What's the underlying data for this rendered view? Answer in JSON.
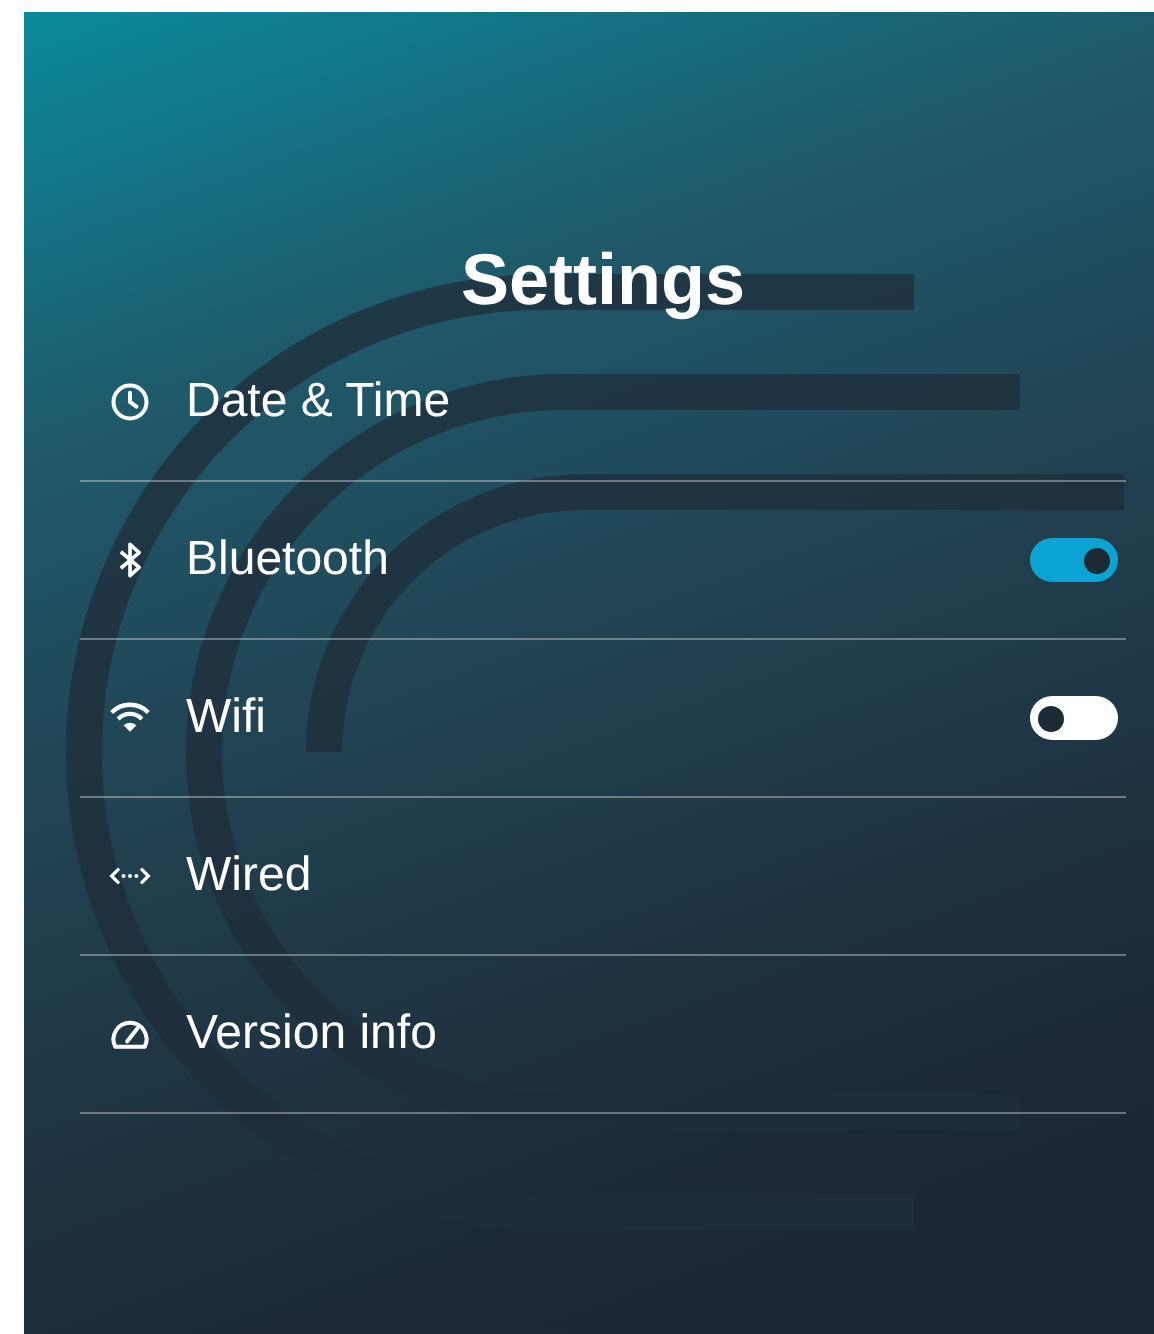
{
  "title": "Settings",
  "items": [
    {
      "kind": "link",
      "label": "Date & Time"
    },
    {
      "kind": "toggle",
      "label": "Bluetooth",
      "on": true
    },
    {
      "kind": "toggle",
      "label": "Wifi",
      "on": false
    },
    {
      "kind": "link",
      "label": "Wired"
    },
    {
      "kind": "link",
      "label": "Version info"
    }
  ]
}
